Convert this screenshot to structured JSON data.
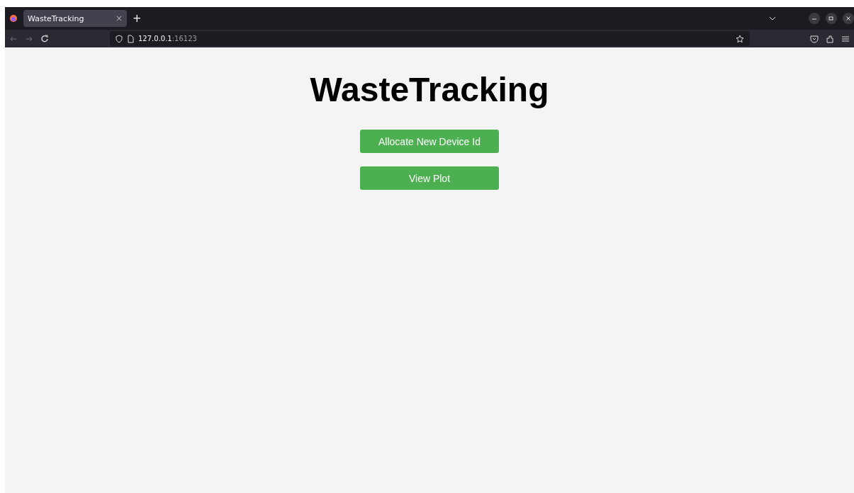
{
  "browser": {
    "tab": {
      "title": "WasteTracking",
      "close": "×",
      "selected": true
    },
    "new_tab": "+",
    "url_host": "127.0.0.1",
    "url_port": ":16123"
  },
  "page": {
    "title": "WasteTracking",
    "buttons": [
      {
        "label": "Allocate New Device Id"
      },
      {
        "label": "View Plot"
      }
    ]
  }
}
